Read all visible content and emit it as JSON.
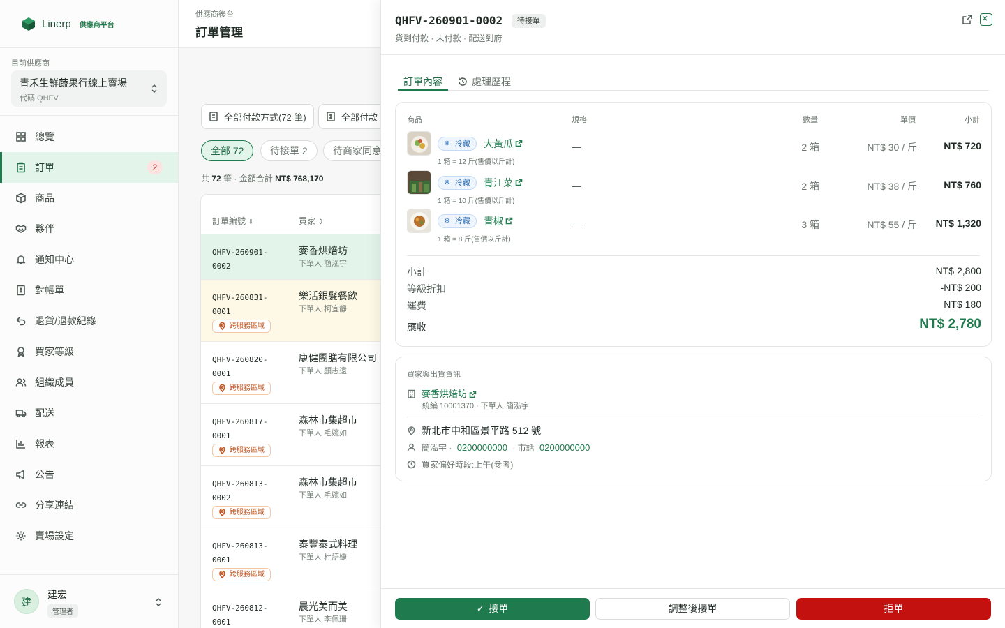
{
  "brand": {
    "name": "Linerp",
    "sub": "供應商平台"
  },
  "supplier": {
    "label": "目前供應商",
    "name": "青禾生鮮蔬果行線上賣場",
    "code": "代碼 QHFV"
  },
  "nav": [
    {
      "label": "總覽",
      "icon": "grid-icon"
    },
    {
      "label": "訂單",
      "icon": "clipboard-icon",
      "badge": "2"
    },
    {
      "label": "商品",
      "icon": "box-icon"
    },
    {
      "label": "夥伴",
      "icon": "handshake-icon"
    },
    {
      "label": "通知中心",
      "icon": "bell-icon"
    },
    {
      "label": "對帳單",
      "icon": "invoice-icon"
    },
    {
      "label": "退貨/退款紀錄",
      "icon": "return-icon"
    },
    {
      "label": "買家等級",
      "icon": "award-icon"
    },
    {
      "label": "組織成員",
      "icon": "users-icon"
    },
    {
      "label": "配送",
      "icon": "truck-icon"
    },
    {
      "label": "報表",
      "icon": "bar-chart-icon"
    },
    {
      "label": "公告",
      "icon": "megaphone-icon"
    },
    {
      "label": "分享連結",
      "icon": "link-icon"
    },
    {
      "label": "賣場設定",
      "icon": "gear-icon"
    }
  ],
  "user": {
    "initial": "建",
    "name": "建宏",
    "role": "管理者"
  },
  "list": {
    "crumb": "供應商後台",
    "title": "訂單管理",
    "filters": [
      "全部付款方式(72 筆)",
      "全部付款"
    ],
    "chips": [
      "全部 72",
      "待接單 2",
      "待商家同意"
    ],
    "summary_prefix": "共",
    "summary_count": "72",
    "summary_mid": "筆 · 金額合計",
    "summary_amount": "NT$ 768,170",
    "col_id": "訂單編號",
    "col_buyer": "買家",
    "cross_label": "跨服務區域",
    "rows": [
      {
        "id": "QHFV-260901-0002",
        "buyer": "麥香烘焙坊",
        "by": "下單人 簡泓宇"
      },
      {
        "id": "QHFV-260831-0001",
        "buyer": "樂活銀髮餐飲",
        "by": "下單人 柯宜靜"
      },
      {
        "id": "QHFV-260820-0001",
        "buyer": "康健團膳有限公司",
        "by": "下單人 顏志遠"
      },
      {
        "id": "QHFV-260817-0001",
        "buyer": "森林市集超市",
        "by": "下單人 毛婉如"
      },
      {
        "id": "QHFV-260813-0002",
        "buyer": "森林市集超市",
        "by": "下單人 毛婉如"
      },
      {
        "id": "QHFV-260813-0001",
        "buyer": "泰豐泰式料理",
        "by": "下單人 杜語婕"
      },
      {
        "id": "QHFV-260812-0001",
        "buyer": "晨光美而美",
        "by": "下單人 李佩珊"
      }
    ]
  },
  "panel": {
    "id": "QHFV-260901-0002",
    "status": "待接單",
    "sub": "貨到付款 · 未付款 · 配送到府",
    "tabs": [
      "訂單內容",
      "處理歷程"
    ],
    "headers": {
      "product": "商品",
      "spec": "規格",
      "qty": "數量",
      "price": "單價",
      "subtotal": "小計"
    },
    "cold_label": "冷藏",
    "items": [
      {
        "name": "大黃瓜",
        "conv": "1 箱 = 12 斤(售價以斤計)",
        "spec": "—",
        "qty": "2 箱",
        "price": "NT$ 30 / 斤",
        "subtotal": "NT$ 720"
      },
      {
        "name": "青江菜",
        "conv": "1 箱 = 10 斤(售價以斤計)",
        "spec": "—",
        "qty": "2 箱",
        "price": "NT$ 38 / 斤",
        "subtotal": "NT$ 760"
      },
      {
        "name": "青椒",
        "conv": "1 箱 = 8 斤(售價以斤計)",
        "spec": "—",
        "qty": "3 箱",
        "price": "NT$ 55 / 斤",
        "subtotal": "NT$ 1,320"
      }
    ],
    "totals": {
      "subtotal_label": "小計",
      "subtotal": "NT$ 2,800",
      "discount_label": "等級折扣",
      "discount": "-NT$ 200",
      "shipping_label": "運費",
      "shipping": "NT$ 180",
      "due_label": "應收",
      "due": "NT$ 2,780"
    },
    "shipping": {
      "title": "買家與出貨資訊",
      "buyer": "麥香烘焙坊",
      "buyer_meta": "統編 10001370 · 下單人 簡泓宇",
      "address": "新北市中和區景平路 512 號",
      "contact_name": "簡泓宇 ·",
      "mobile": "0200000000",
      "tel_label": "· 市話",
      "tel": "0200000000",
      "time": "買家偏好時段:上午(參考)"
    },
    "actions": {
      "accept": "接單",
      "adjust": "調整後接單",
      "reject": "拒單"
    }
  }
}
